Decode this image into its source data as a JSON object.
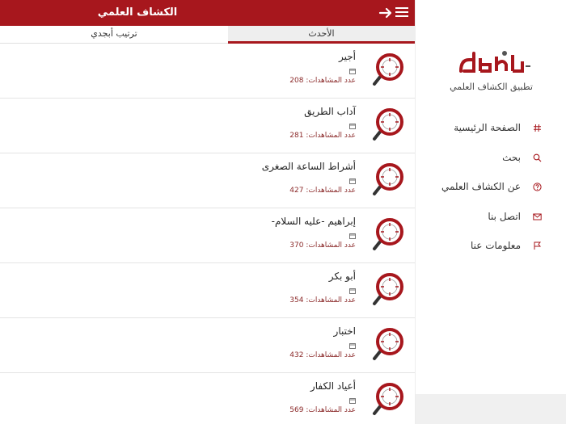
{
  "header": {
    "title": "الكشاف العلمي"
  },
  "tabs": {
    "latest": "الأحدث",
    "alphabetical": "ترتيب أبجدي"
  },
  "list": [
    {
      "title": "أجير",
      "views": "عدد المشاهدات: 208"
    },
    {
      "title": "آداب الطريق",
      "views": "عدد المشاهدات: 281"
    },
    {
      "title": "أشراط الساعة الصغرى",
      "views": "عدد المشاهدات: 427"
    },
    {
      "title": "إبراهيم -عليه السلام-",
      "views": "عدد المشاهدات: 370"
    },
    {
      "title": "أبو بكر",
      "views": "عدد المشاهدات: 354"
    },
    {
      "title": "اختبار",
      "views": "عدد المشاهدات: 432"
    },
    {
      "title": "أعياد الكفار",
      "views": "عدد المشاهدات: 569"
    }
  ],
  "sidebar": {
    "app_name": "تطبيق الكشاف العلمي",
    "items": [
      {
        "label": "الصفحة الرئيسية",
        "icon": "hash-icon"
      },
      {
        "label": "بحث",
        "icon": "search-icon"
      },
      {
        "label": "عن الكشاف العلمي",
        "icon": "help-icon"
      },
      {
        "label": "اتصل بنا",
        "icon": "mail-icon"
      },
      {
        "label": "معلومات عنا",
        "icon": "flag-icon"
      }
    ]
  },
  "colors": {
    "accent": "#a7171d",
    "views_text": "#8b2a2a"
  }
}
